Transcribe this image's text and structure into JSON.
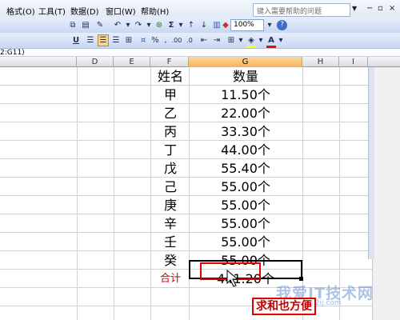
{
  "menu": {
    "items": [
      "格式(O)",
      "工具(T)",
      "数据(D)",
      "窗口(W)",
      "帮助(H)"
    ],
    "help_placeholder": "键入需要帮助的问题"
  },
  "toolbar": {
    "zoom": "100%",
    "percent_label": "%",
    "buttons": [
      "bold-button",
      "italic-button",
      "underline-button"
    ]
  },
  "formula_bar": {
    "name_box": "2:G11)"
  },
  "columns": [
    "D",
    "E",
    "F",
    "G",
    "H",
    "I"
  ],
  "selected_column": "G",
  "table": {
    "header_name": "姓名",
    "header_qty": "数量",
    "rows": [
      {
        "name": "甲",
        "qty": "11.50个"
      },
      {
        "name": "乙",
        "qty": "22.00个"
      },
      {
        "name": "丙",
        "qty": "33.30个"
      },
      {
        "name": "丁",
        "qty": "44.00个"
      },
      {
        "name": "戊",
        "qty": "55.40个"
      },
      {
        "name": "己",
        "qty": "55.00个"
      },
      {
        "name": "庚",
        "qty": "55.00个"
      },
      {
        "name": "辛",
        "qty": "55.00个"
      },
      {
        "name": "壬",
        "qty": "55.00个"
      },
      {
        "name": "癸",
        "qty": "55.00个"
      }
    ],
    "total_label": "合计",
    "total_value": "441.20个"
  },
  "annotation": {
    "caption": "求和也方便"
  },
  "watermark": {
    "text": "我爱IT技术网",
    "url": "52ij.com"
  },
  "colors": {
    "highlight_column": "#f6b15d",
    "annotation_red": "#e00000",
    "total_label_red": "#d00000"
  }
}
